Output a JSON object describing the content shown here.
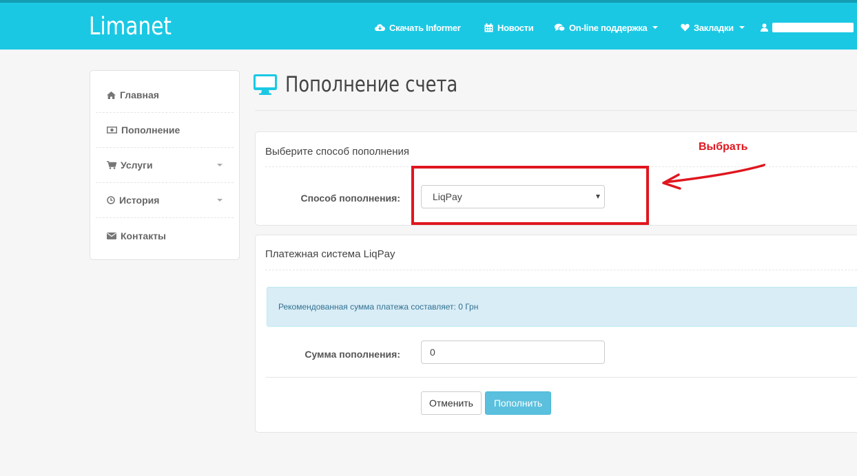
{
  "navbar": {
    "brand": "Limanet",
    "items": [
      {
        "label": "Скачать Informer",
        "icon": "cloud-download-icon"
      },
      {
        "label": "Новости",
        "icon": "calendar-icon"
      },
      {
        "label": "On-line поддержка",
        "icon": "comments-icon"
      },
      {
        "label": "Закладки",
        "icon": "heart-icon"
      }
    ],
    "user_icon": "user-icon"
  },
  "sidebar": {
    "items": [
      {
        "label": "Главная",
        "icon": "home-icon"
      },
      {
        "label": "Пополнение",
        "icon": "money-icon"
      },
      {
        "label": "Услуги",
        "icon": "shopping-cart-icon"
      },
      {
        "label": "История",
        "icon": "clock-icon"
      },
      {
        "label": "Контакты",
        "icon": "envelope-icon"
      }
    ]
  },
  "page": {
    "title": "Пополнение счета",
    "title_icon": "desktop-icon"
  },
  "method_panel": {
    "heading": "Выберите способ пополнения",
    "label": "Способ пополнения:",
    "selected": "LiqPay"
  },
  "payment_panel": {
    "heading": "Платежная система LiqPay",
    "alert": "Рекомендованная сумма платежа составляет: 0 Грн",
    "amount_label": "Сумма пополнения:",
    "amount_value": "0",
    "cancel_label": "Отменить",
    "submit_label": "Пополнить"
  },
  "annotation": {
    "text": "Выбрать"
  },
  "colors": {
    "navbar": "#1bc8e4",
    "accent_button": "#5bc0de",
    "annotation": "#e0161e",
    "alert_bg": "#d9edf7"
  }
}
